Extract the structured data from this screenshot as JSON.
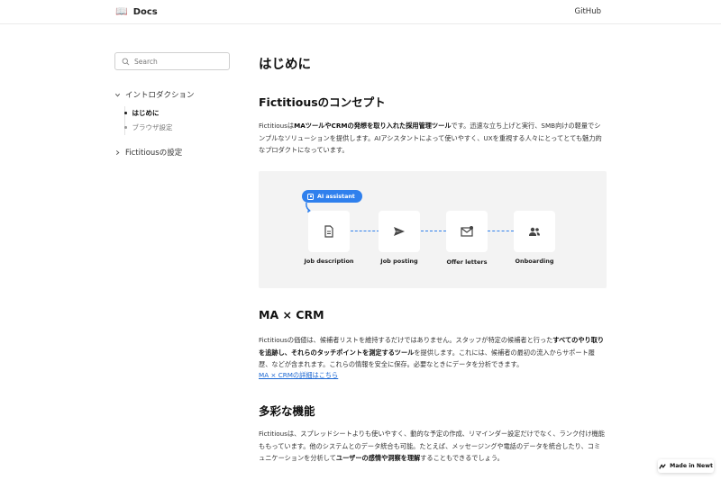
{
  "header": {
    "brand_icon": "📖",
    "brand_label": "Docs",
    "github_label": "GitHub"
  },
  "sidebar": {
    "search_placeholder": "Search",
    "groups": [
      {
        "label": "イントロダクション",
        "expanded": true,
        "items": [
          {
            "label": "はじめに",
            "active": true
          },
          {
            "label": "ブラウザ設定",
            "active": false
          }
        ]
      },
      {
        "label": "Fictitiousの設定",
        "expanded": false
      }
    ]
  },
  "main": {
    "title": "はじめに",
    "sections": [
      {
        "heading": "Fictitiousのコンセプト",
        "paragraph_html": "Fictitiousは<b>MAツールやCRMの発想を取り入れた採用管理ツール</b>です。迅速な立ち上げと実行、SMB向けの軽量でシンプルなソリューションを提供します。AIアシスタントによって使いやすく、UXを重視する人々にとってとても魅力的なプロダクトになっています。"
      },
      {
        "heading": "MA × CRM",
        "paragraph_html": "Fictitiousの価値は、候補者リストを維持するだけではありません。スタッフが特定の候補者と行った<b>すべてのやり取りを追跡し、それらのタッチポイントを測定するツール</b>を提供します。これには、候補者の最初の流入からサポート履歴、などが含まれます。これらの情報を安全に保存。必要なときにデータを分析できます。",
        "link_label": "MA × CRMの詳細はこちら"
      },
      {
        "heading": "多彩な機能",
        "paragraph_html": "Fictitiousは、スプレッドシートよりも使いやすく、動的な予定の作成、リマインダー設定だけでなく、ランク付け機能ももっています。他のシステムとのデータ統合も可能。たとえば、メッセージングや電話のデータを統合したり、コミュニケーションを分析して<b>ユーザーの感情や洞察を理解</b>することもできるでしょう。"
      }
    ],
    "figure": {
      "ai_label": "AI assistant",
      "steps": [
        {
          "label": "Job description",
          "icon": "document-icon"
        },
        {
          "label": "Job posting",
          "icon": "send-icon"
        },
        {
          "label": "Offer letters",
          "icon": "mail-icon"
        },
        {
          "label": "Onboarding",
          "icon": "people-icon"
        }
      ],
      "accent": "#2f80ed"
    }
  },
  "badge": {
    "label": "Made in Newt"
  },
  "colors": {
    "link": "#1a66d2",
    "accent": "#2f80ed"
  }
}
